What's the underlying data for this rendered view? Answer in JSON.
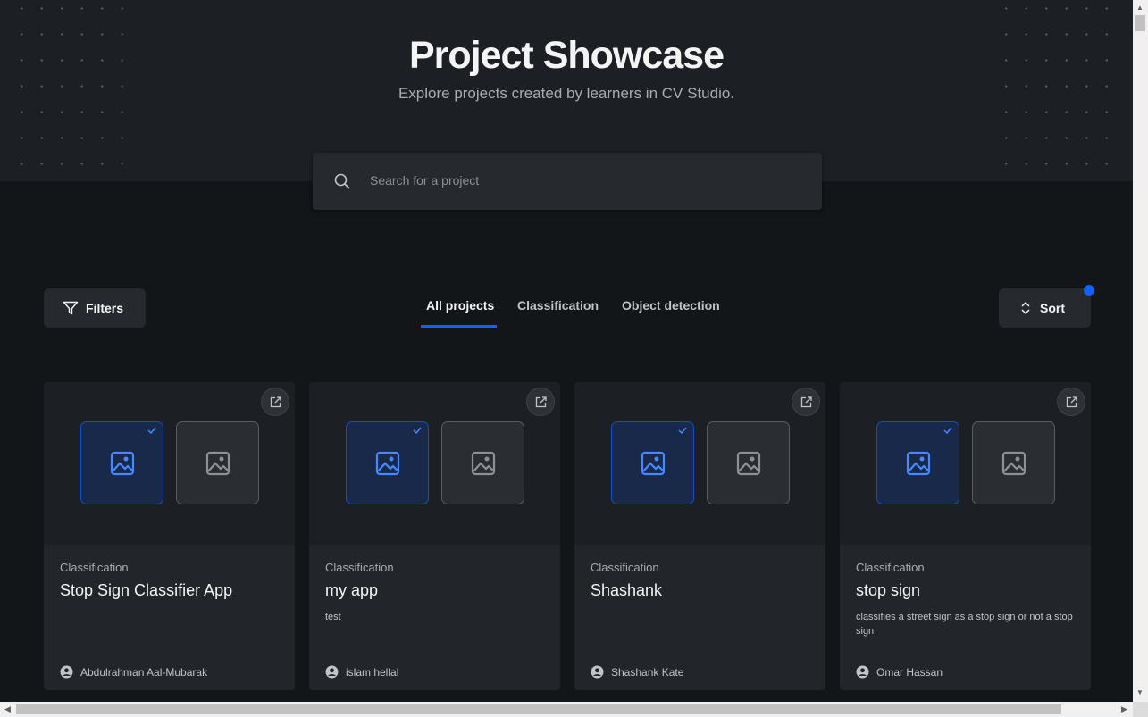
{
  "header": {
    "title": "Project Showcase",
    "subtitle": "Explore projects created by learners in CV Studio."
  },
  "search": {
    "placeholder": "Search for a project",
    "icon": "search-icon"
  },
  "toolbar": {
    "filters_label": "Filters",
    "sort_label": "Sort",
    "tabs": [
      "All projects",
      "Classification",
      "Object detection"
    ],
    "active_tab": "All projects"
  },
  "colors": {
    "accent": "#0f62fe",
    "background": "#121619",
    "card": "#22262a"
  },
  "projects": [
    {
      "category": "Classification",
      "name": "Stop Sign Classifier App",
      "description": "",
      "author": "Abdulrahman Aal-Mubarak"
    },
    {
      "category": "Classification",
      "name": "my app",
      "description": "test",
      "author": "islam hellal"
    },
    {
      "category": "Classification",
      "name": "Shashank",
      "description": "",
      "author": "Shashank Kate"
    },
    {
      "category": "Classification",
      "name": "stop sign",
      "description": "classifies a street sign as a stop sign or not a stop sign",
      "author": "Omar Hassan"
    }
  ]
}
